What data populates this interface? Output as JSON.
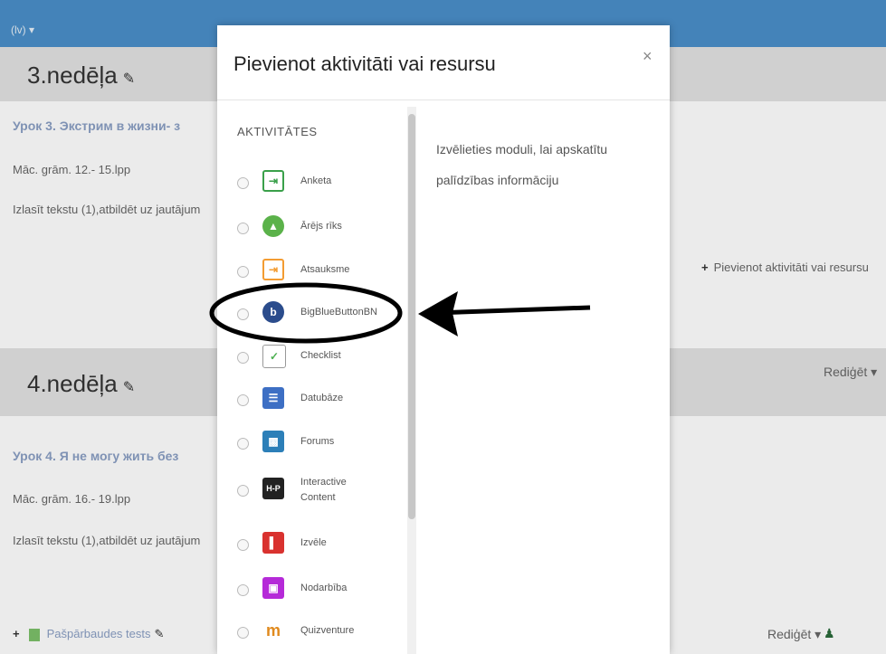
{
  "topbar": {
    "lang": "(lv) ▾"
  },
  "sections": [
    {
      "title": "3.nedēļa",
      "lesson_link": "Урок 3. Экстрим в жизни- з",
      "line1": "Māc. grām. 12.- 15.lpp",
      "line2": "Izlasīt tekstu (1),atbildēt uz jautājum",
      "add_activity": "Pievienot aktivitāti vai resursu"
    },
    {
      "title": "4.nedēļa",
      "edit_label": "Rediģēt ▾",
      "lesson_link": "Урок 4. Я не могу жить без",
      "line1": "Māc. grām. 16.- 19.lpp",
      "line2": "Izlasīt tekstu (1),atbildēt uz jautājum",
      "bottom_item": "Pašpārbaudes tests",
      "bottom_edit": "Rediģēt ▾"
    }
  ],
  "modal": {
    "title": "Pievienot aktivitāti vai resursu",
    "close": "×",
    "group_label": "AKTIVITĀTES",
    "help_text": "Izvēlieties moduli, lai apskatītu palīdzības informāciju",
    "items": [
      {
        "label": "Anketa",
        "icon": "feedback-icon",
        "color": "#3aa04a"
      },
      {
        "label": "Ārējs rīks",
        "icon": "external-tool-icon",
        "color": "#5bb24a"
      },
      {
        "label": "Atsauksme",
        "icon": "feedback-arrow-icon",
        "color": "#f39c32"
      },
      {
        "label": "BigBlueButtonBN",
        "icon": "bigbluebutton-icon",
        "color": "#2b4c8c"
      },
      {
        "label": "Checklist",
        "icon": "checklist-icon",
        "color": "#4caf50"
      },
      {
        "label": "Datubāze",
        "icon": "database-icon",
        "color": "#3d6fc4"
      },
      {
        "label": "Forums",
        "icon": "forum-icon",
        "color": "#2c7fb8"
      },
      {
        "label": "Interactive Content",
        "icon": "h5p-icon",
        "color": "#222222"
      },
      {
        "label": "Izvēle",
        "icon": "choice-icon",
        "color": "#d9322f"
      },
      {
        "label": "Nodarbība",
        "icon": "lesson-icon",
        "color": "#b52ad8"
      },
      {
        "label": "Quizventure",
        "icon": "quizventure-icon",
        "color": "#e08a1e"
      }
    ]
  }
}
